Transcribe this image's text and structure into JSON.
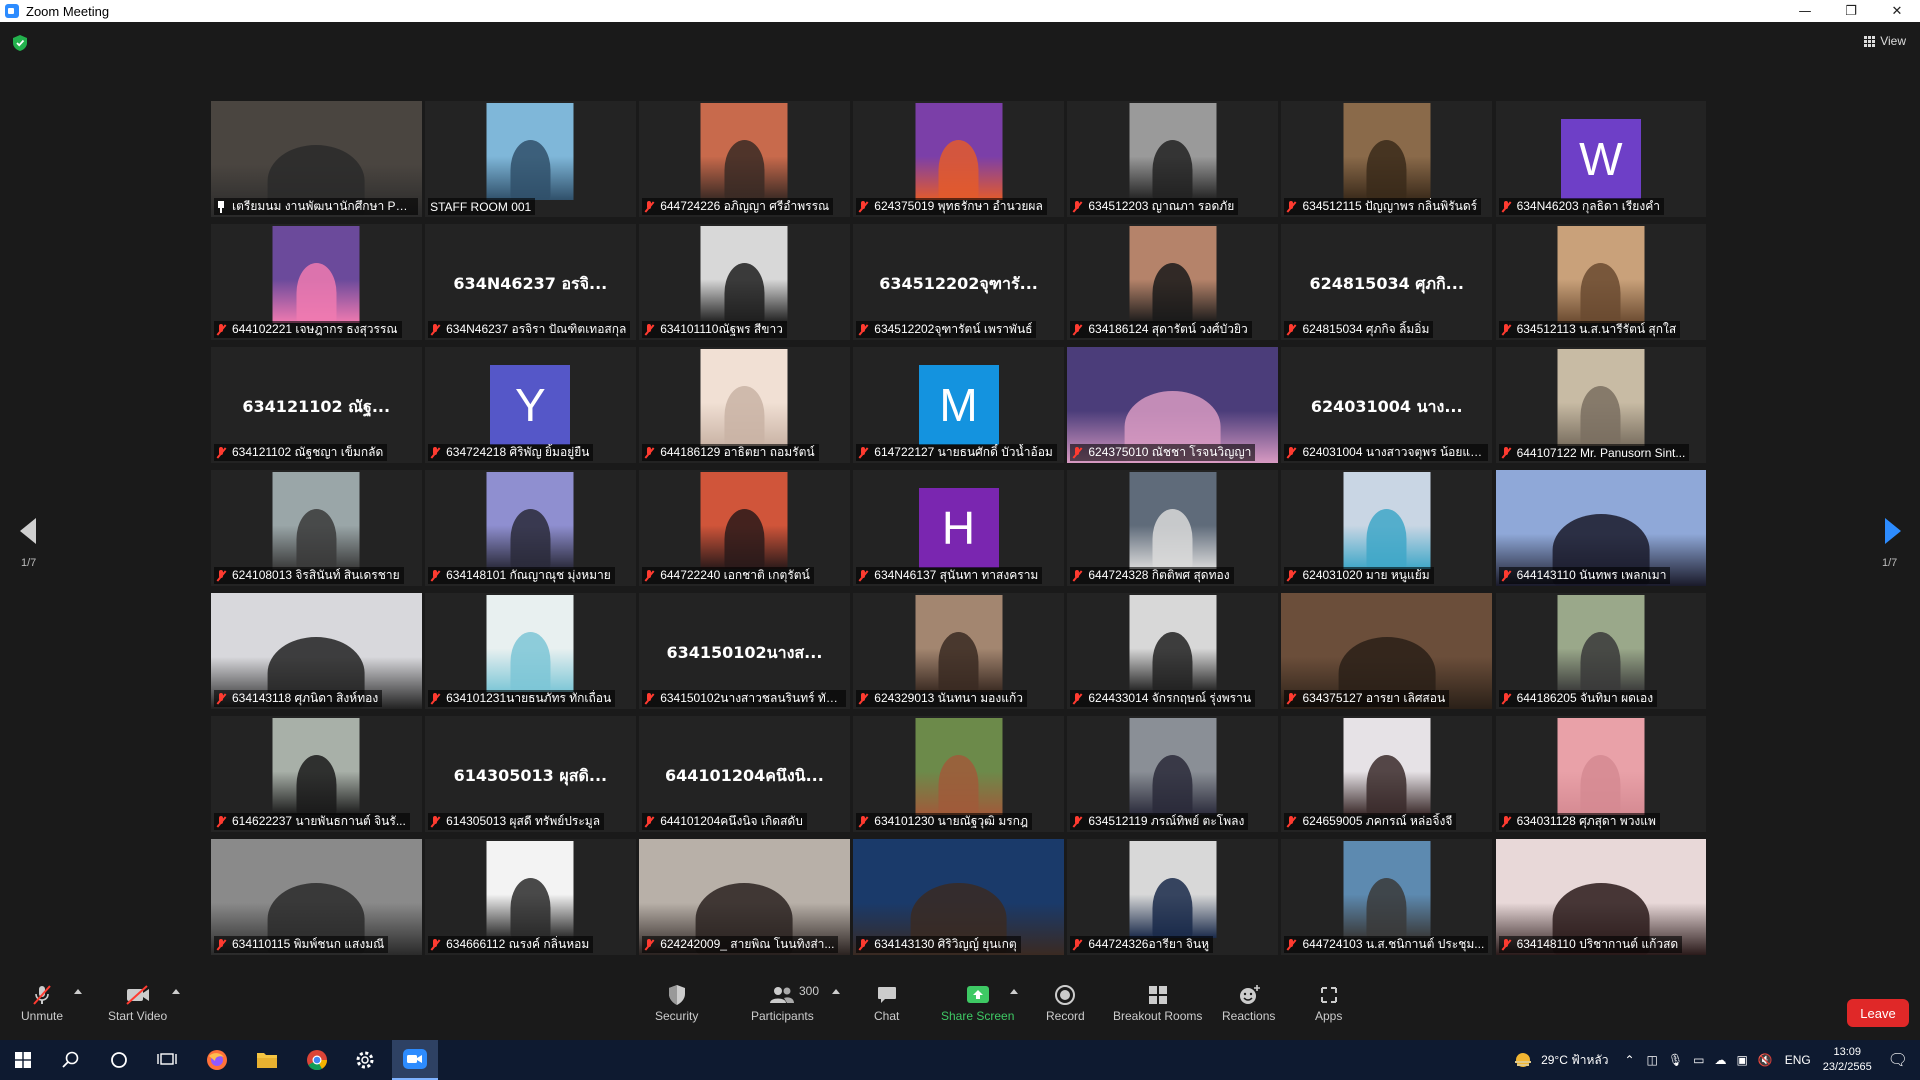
{
  "window": {
    "title": "Zoom Meeting",
    "controls": [
      "—",
      "❐",
      "✕"
    ]
  },
  "view_label": "View",
  "pagination": {
    "left": "1/7",
    "right": "1/7"
  },
  "participants": [
    {
      "name": "เตรียมนม งานพัฒนานักศึกษา PBRU",
      "type": "photo",
      "bg": "#4a4540",
      "fg": "#2a2a2a",
      "wide": true,
      "pinned": true,
      "active": true
    },
    {
      "name": "STAFF ROOM 001",
      "type": "photo",
      "bg": "#7fb7d9",
      "fg": "#30506a",
      "nomute": true
    },
    {
      "name": "644724226 อภิญญา ศรีอำพรรณ",
      "type": "photo",
      "bg": "#c86a4c",
      "fg": "#3a2a24"
    },
    {
      "name": "624375019 พุทธรักษา อำนวยผล",
      "type": "photo",
      "bg": "#7b3fa8",
      "fg": "#e35b2c"
    },
    {
      "name": "634512203 ญาณภา รอดภัย",
      "type": "photo",
      "bg": "#9a9a9a",
      "fg": "#222222"
    },
    {
      "name": "634512115 ปัญญาพร กลิ่นพิรันดร์",
      "type": "photo",
      "bg": "#8a6a4a",
      "fg": "#3a2a1a"
    },
    {
      "name": "634N46203 กุลธิดา เรียงคำ",
      "type": "letter",
      "letter": "W",
      "bg": "#6e3fc7"
    },
    {
      "name": "644102221 เจษฎากร ธงสุวรรณ",
      "type": "photo",
      "bg": "#6b4a9b",
      "fg": "#f07ab0"
    },
    {
      "name": "634N46237 อรจิรา ปัณฑิตเทอสกุล",
      "type": "text",
      "center": "634N46237 อรจิ..."
    },
    {
      "name": "634101110ณัฐพร สีขาว",
      "type": "photo",
      "bg": "#d8d8d8",
      "fg": "#1e1e1e"
    },
    {
      "name": "634512202จุฑารัตน์ เพราพันธ์",
      "type": "text",
      "center": "634512202จุฑารั..."
    },
    {
      "name": "634186124 สุดารัตน์ วงศ์บัวยิว",
      "type": "photo",
      "bg": "#b5836a",
      "fg": "#1a1a1a"
    },
    {
      "name": "624815034 ศุภกิจ ลิ้มอิ่ม",
      "type": "text",
      "center": "624815034 ศุภกิ..."
    },
    {
      "name": "634512113 น.ส.นารีรัตน์ สุกใส",
      "type": "photo",
      "bg": "#c9a17a",
      "fg": "#6a4a30"
    },
    {
      "name": "634121102 ณัฐชญา เข็มกลัด",
      "type": "text",
      "center": "634121102 ณัฐ..."
    },
    {
      "name": "634724218 ศิริพัญ ยิ้มอยู่ยืน",
      "type": "letter",
      "letter": "Y",
      "bg": "#5557c8"
    },
    {
      "name": "644186129 อาธิตยา ถอมรัตน์",
      "type": "photo",
      "bg": "#f1e0d4",
      "fg": "#c9b3a5"
    },
    {
      "name": "614722127 นายธนศักดิ์ บัวน้ำอ้อม",
      "type": "letter",
      "letter": "M",
      "bg": "#1493df"
    },
    {
      "name": "624375010 ณัชชา โรจนวิญญา",
      "type": "photo",
      "bg": "#4b3d7a",
      "fg": "#d89ac2",
      "wide": true
    },
    {
      "name": "624031004 นางสาวจตุพร น้อยแพ...",
      "type": "text",
      "center": "624031004 นาง..."
    },
    {
      "name": "644107122 Mr. Panusorn Sint...",
      "type": "photo",
      "bg": "#c8bba4",
      "fg": "#7a6f60"
    },
    {
      "name": "624108013 จิรสินันท์ สินเดรชาย",
      "type": "photo",
      "bg": "#9aa6a8",
      "fg": "#3a3a3a"
    },
    {
      "name": "634148101 กัณญาณุช มุ่งหมาย",
      "type": "photo",
      "bg": "#8f8fd0",
      "fg": "#2a2a3a"
    },
    {
      "name": "644722240 เอกชาติ เกตุรัตน์",
      "type": "photo",
      "bg": "#d0553a",
      "fg": "#2a1a1a"
    },
    {
      "name": "634N46137 สุนันทา ทาสงคราม",
      "type": "letter",
      "letter": "H",
      "bg": "#7a26b0"
    },
    {
      "name": "644724328 กิตติพศ สุดทอง",
      "type": "photo",
      "bg": "#5f6b7a",
      "fg": "#d9d9d9"
    },
    {
      "name": "624031020 มาย หนูแย้ม",
      "type": "photo",
      "bg": "#c9d6e4",
      "fg": "#3fa7c8"
    },
    {
      "name": "644143110 นันทพร เพลกเมา",
      "type": "photo",
      "bg": "#8fa8d8",
      "fg": "#1a1a2a",
      "wide": true
    },
    {
      "name": "634143118 ศุภนิดา สิงห์ทอง",
      "type": "photo",
      "bg": "#d8d8dc",
      "fg": "#222222",
      "wide": true
    },
    {
      "name": "634101231นายธนภัทร ทักเถื่อน",
      "type": "photo",
      "bg": "#e8f0f0",
      "fg": "#7cc6d6"
    },
    {
      "name": "634150102นางสาวชลนรินทร์ ทัน...",
      "type": "text",
      "center": "634150102นางส..."
    },
    {
      "name": "624329013 นันทนา มองแก้ว",
      "type": "photo",
      "bg": "#a38670",
      "fg": "#3a2a22"
    },
    {
      "name": "624433014 จักรกฤษณ์ รุ่งพราน",
      "type": "photo",
      "bg": "#d8d8d8",
      "fg": "#222222"
    },
    {
      "name": "634375127 อารยา เลิศสอน",
      "type": "photo",
      "bg": "#6b4e3a",
      "fg": "#2a2018",
      "wide": true
    },
    {
      "name": "644186205 จันทิมา ผดเอง",
      "type": "photo",
      "bg": "#9aa88a",
      "fg": "#3a3a3a"
    },
    {
      "name": "614622237 นายพันธกานต์ จินรั...",
      "type": "photo",
      "bg": "#a8b0a8",
      "fg": "#1a1a1a"
    },
    {
      "name": "614305013 ผุสดี ทรัพย์ประมูล",
      "type": "text",
      "center": "614305013 ผุสดิ..."
    },
    {
      "name": "644101204คนึงนิจ เกิดสดับ",
      "type": "text",
      "center": "644101204คนึงนิ..."
    },
    {
      "name": "634101230 นายณัฐวุฒิ มรกฎ",
      "type": "photo",
      "bg": "#6c8a4a",
      "fg": "#a05a3a"
    },
    {
      "name": "634512119 ภรณ์ทิพย์ ตะโพลง",
      "type": "photo",
      "bg": "#8a8f96",
      "fg": "#2a2a3a"
    },
    {
      "name": "624659005 ภคกรณ์ หล่อจิ้งจี",
      "type": "photo",
      "bg": "#e6e2e6",
      "fg": "#3a2a2a"
    },
    {
      "name": "634031128 ศุภสุดา พวงแพ",
      "type": "photo",
      "bg": "#e9a1a8",
      "fg": "#d58a92"
    },
    {
      "name": "634110115 พิมพ์ชนก แสงมณี",
      "type": "photo",
      "bg": "#8a8a8a",
      "fg": "#2a2a2a",
      "wide": true
    },
    {
      "name": "634666112 ณรงค์ กลิ่นหอม",
      "type": "photo",
      "bg": "#f3f3f3",
      "fg": "#2a2a2a"
    },
    {
      "name": "624242009_ สายพิณ โนนทิงส่า...",
      "type": "photo",
      "bg": "#b8b0a8",
      "fg": "#2a2220",
      "wide": true
    },
    {
      "name": "634143130 ศิริวิญญ์ ยุนเกตุ",
      "type": "photo",
      "bg": "#1a3a6a",
      "fg": "#3a2a22",
      "wide": true
    },
    {
      "name": "644724326อารียา จินหู",
      "type": "photo",
      "bg": "#d8d8d8",
      "fg": "#1a2a4a"
    },
    {
      "name": "644724103 น.ส.ชนิกานต์ ประชุม...",
      "type": "photo",
      "bg": "#5d8ab0",
      "fg": "#3a3a3a"
    },
    {
      "name": "634148110 ปริชากานต์ แก้วสด",
      "type": "photo",
      "bg": "#e8d8d8",
      "fg": "#2a1a1a",
      "wide": true
    }
  ],
  "toolbar": {
    "unmute": "Unmute",
    "start_video": "Start Video",
    "security": "Security",
    "participants": "Participants",
    "participant_count": "300",
    "chat": "Chat",
    "share_screen": "Share Screen",
    "record": "Record",
    "breakout_rooms": "Breakout Rooms",
    "reactions": "Reactions",
    "apps": "Apps",
    "leave": "Leave"
  },
  "colors": {
    "accent": "#2d8cff",
    "share": "#3ec964",
    "leave": "#e02828",
    "active_speaker": "#c8e03b",
    "muted": "#ff3b30"
  },
  "taskbar": {
    "weather": "29°C ฟ้าหลัว",
    "language": "ENG",
    "time": "13:09",
    "date": "23/2/2565"
  }
}
